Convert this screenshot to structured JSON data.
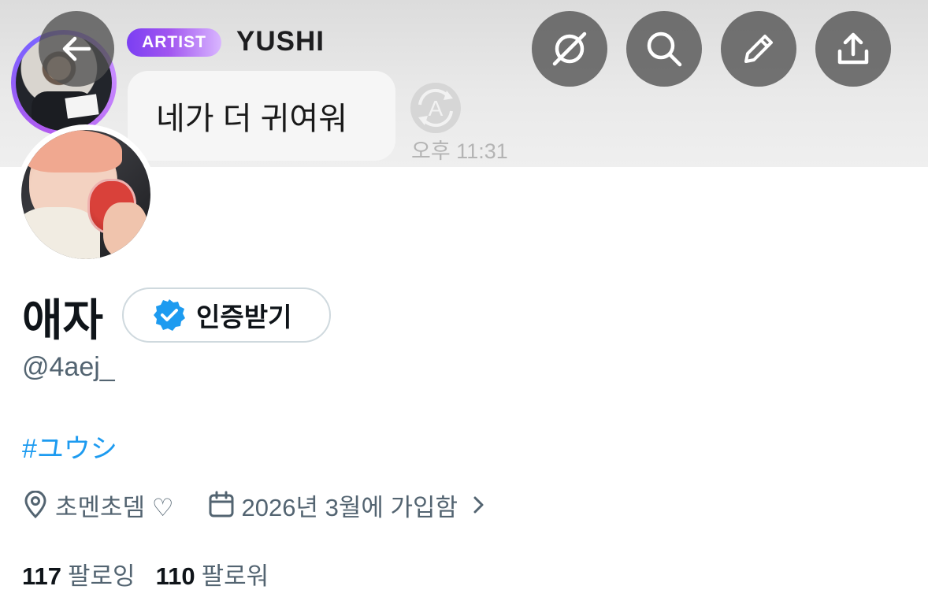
{
  "header": {
    "badge": "ARTIST",
    "artist_name": "YUSHI",
    "message": "네가 더 귀여워",
    "time": "오후 11:31",
    "buttons": {
      "back_icon": "arrow-left-icon",
      "grok_icon": "grok-icon",
      "search_icon": "search-icon",
      "edit_icon": "pencil-icon",
      "share_icon": "share-icon"
    }
  },
  "profile": {
    "display_name": "애자",
    "verify_label": "인증받기",
    "handle": "@4aej_",
    "hashtag": "#ユウシ",
    "location": "초멘초뎀 ♡",
    "joined": "2026년 3월에 가입함",
    "following_count": "117",
    "following_label": "팔로잉",
    "followers_count": "110",
    "followers_label": "팔로워"
  },
  "colors": {
    "accent": "#1d9bf0",
    "verified": "#1d9bf0",
    "secondary_text": "#536471",
    "badge_start": "#7b3ff2",
    "badge_end": "#d9b6ff"
  }
}
